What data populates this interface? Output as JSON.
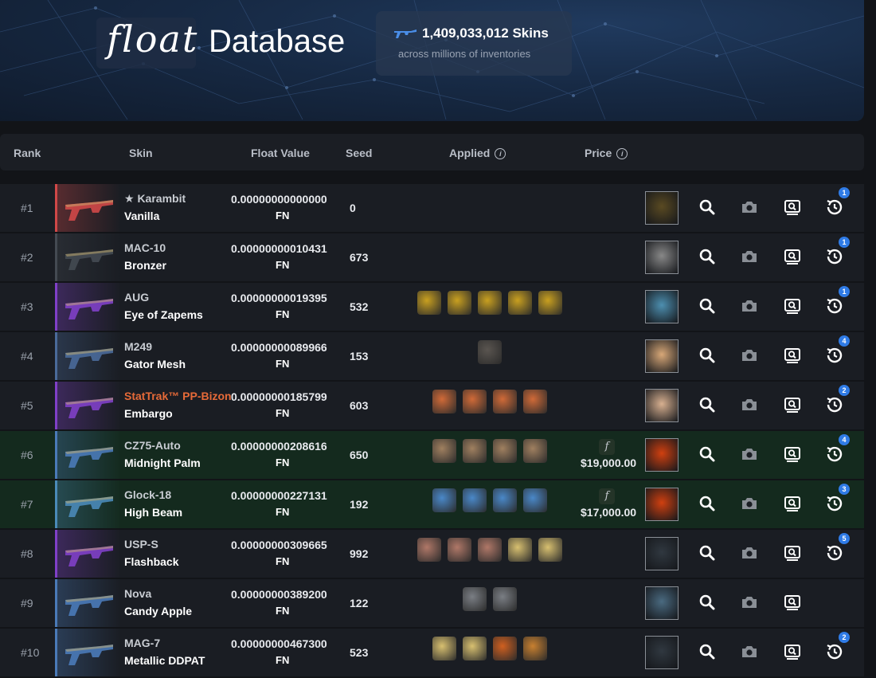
{
  "header": {
    "logo": "float",
    "title": "Database",
    "count": "1,409,033,012 Skins",
    "subtitle": "across millions of inventories"
  },
  "columns": {
    "rank": "Rank",
    "skin": "Skin",
    "float": "Float Value",
    "seed": "Seed",
    "applied": "Applied",
    "price": "Price"
  },
  "colors": {
    "accent": "#2f7be6",
    "stattrak": "#e66a38",
    "highlight_row": "#142a1e"
  },
  "rows": [
    {
      "rank": "#1",
      "line1": "★ Karambit",
      "line2": "Vanilla",
      "float": "0.00000000000000",
      "wear": "FN",
      "seed": "0",
      "price": "",
      "badge": "1",
      "rarity": "#d04848",
      "stattrak": false,
      "highlight": false,
      "stickers": [],
      "avatar": "#5a4a22"
    },
    {
      "rank": "#2",
      "line1": "MAC-10",
      "line2": "Bronzer",
      "float": "0.00000000010431",
      "wear": "FN",
      "seed": "673",
      "price": "",
      "badge": "1",
      "rarity": "#444a52",
      "stattrak": false,
      "highlight": false,
      "stickers": [],
      "avatar": "#888888"
    },
    {
      "rank": "#3",
      "line1": "AUG",
      "line2": "Eye of Zapems",
      "float": "0.00000000019395",
      "wear": "FN",
      "seed": "532",
      "price": "",
      "badge": "1",
      "rarity": "#8040c8",
      "stattrak": false,
      "highlight": false,
      "stickers": [
        "#c9a020",
        "#c9a020",
        "#c9a020",
        "#c9a020",
        "#c9a020"
      ],
      "avatar": "#4d8fb0"
    },
    {
      "rank": "#4",
      "line1": "M249",
      "line2": "Gator Mesh",
      "float": "0.00000000089966",
      "wear": "FN",
      "seed": "153",
      "price": "",
      "badge": "4",
      "rarity": "#4a6a9a",
      "stattrak": false,
      "highlight": false,
      "stickers": [
        "#5a5550"
      ],
      "avatar": "#d8a878"
    },
    {
      "rank": "#5",
      "line1": "StatTrak™ PP-Bizon",
      "line2": "Embargo",
      "float": "0.00000000185799",
      "wear": "FN",
      "seed": "603",
      "price": "",
      "badge": "2",
      "rarity": "#8040c8",
      "stattrak": true,
      "highlight": false,
      "stickers": [
        "#d06a38",
        "#d06a38",
        "#d06a38",
        "#d06a38"
      ],
      "avatar": "#d8b090"
    },
    {
      "rank": "#6",
      "line1": "CZ75-Auto",
      "line2": "Midnight Palm",
      "float": "0.00000000208616",
      "wear": "FN",
      "seed": "650",
      "price": "$19,000.00",
      "badge": "4",
      "rarity": "#4a7ab8",
      "stattrak": false,
      "highlight": true,
      "stickers": [
        "#a08060",
        "#a08060",
        "#a08060",
        "#a08060"
      ],
      "avatar": "#d04010"
    },
    {
      "rank": "#7",
      "line1": "Glock-18",
      "line2": "High Beam",
      "float": "0.00000000227131",
      "wear": "FN",
      "seed": "192",
      "price": "$17,000.00",
      "badge": "3",
      "rarity": "#4a8ab8",
      "stattrak": false,
      "highlight": true,
      "stickers": [
        "#4a88c8",
        "#4a88c8",
        "#4a88c8",
        "#4a88c8"
      ],
      "avatar": "#d04010"
    },
    {
      "rank": "#8",
      "line1": "USP-S",
      "line2": "Flashback",
      "float": "0.00000000309665",
      "wear": "FN",
      "seed": "992",
      "price": "",
      "badge": "5",
      "rarity": "#8040c8",
      "stattrak": false,
      "highlight": false,
      "stickers": [
        "#b07868",
        "#b07868",
        "#b07868",
        "#d8c070",
        "#d8c070"
      ],
      "avatar": "#303840"
    },
    {
      "rank": "#9",
      "line1": "Nova",
      "line2": "Candy Apple",
      "float": "0.00000000389200",
      "wear": "FN",
      "seed": "122",
      "price": "",
      "badge": "",
      "rarity": "#4a7ab8",
      "stattrak": false,
      "highlight": false,
      "stickers": [
        "#7a7e84",
        "#7a7e84"
      ],
      "avatar": "#4a6a80"
    },
    {
      "rank": "#10",
      "line1": "MAG-7",
      "line2": "Metallic DDPAT",
      "float": "0.00000000467300",
      "wear": "FN",
      "seed": "523",
      "price": "",
      "badge": "2",
      "rarity": "#4a7ab8",
      "stattrak": false,
      "highlight": false,
      "stickers": [
        "#d8c070",
        "#d8c070",
        "#d06020",
        "#c88030"
      ],
      "avatar": "#303840"
    }
  ]
}
